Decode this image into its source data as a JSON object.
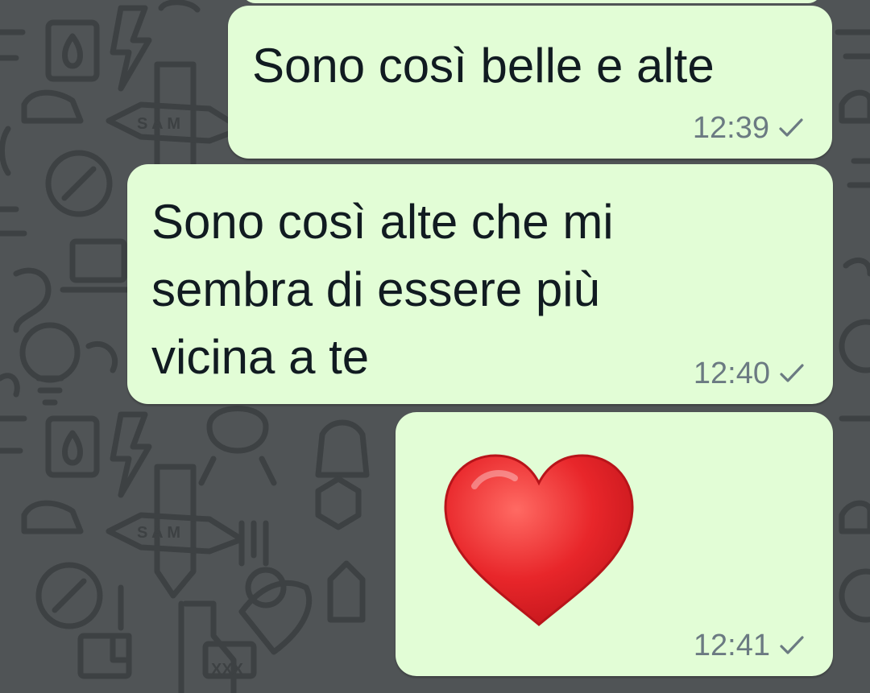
{
  "chat": {
    "messages": [
      {
        "text": "Sono così belle e alte",
        "time": "12:39",
        "status": "sent-single-check-icon"
      },
      {
        "text": "Sono così alte che mi\nsembra di essere più\nvicina a te",
        "time": "12:40",
        "status": "sent-single-check-icon"
      },
      {
        "emoji": "❤️",
        "emoji_name": "red-heart-icon",
        "time": "12:41",
        "status": "sent-single-check-icon"
      }
    ]
  },
  "colors": {
    "wallpaper": "#505456",
    "doodle": "#3b3f41",
    "outgoing_bubble": "#e2fdd6",
    "message_text": "#111b21",
    "meta_text": "#6b7a82",
    "heart": "#e0262a"
  }
}
